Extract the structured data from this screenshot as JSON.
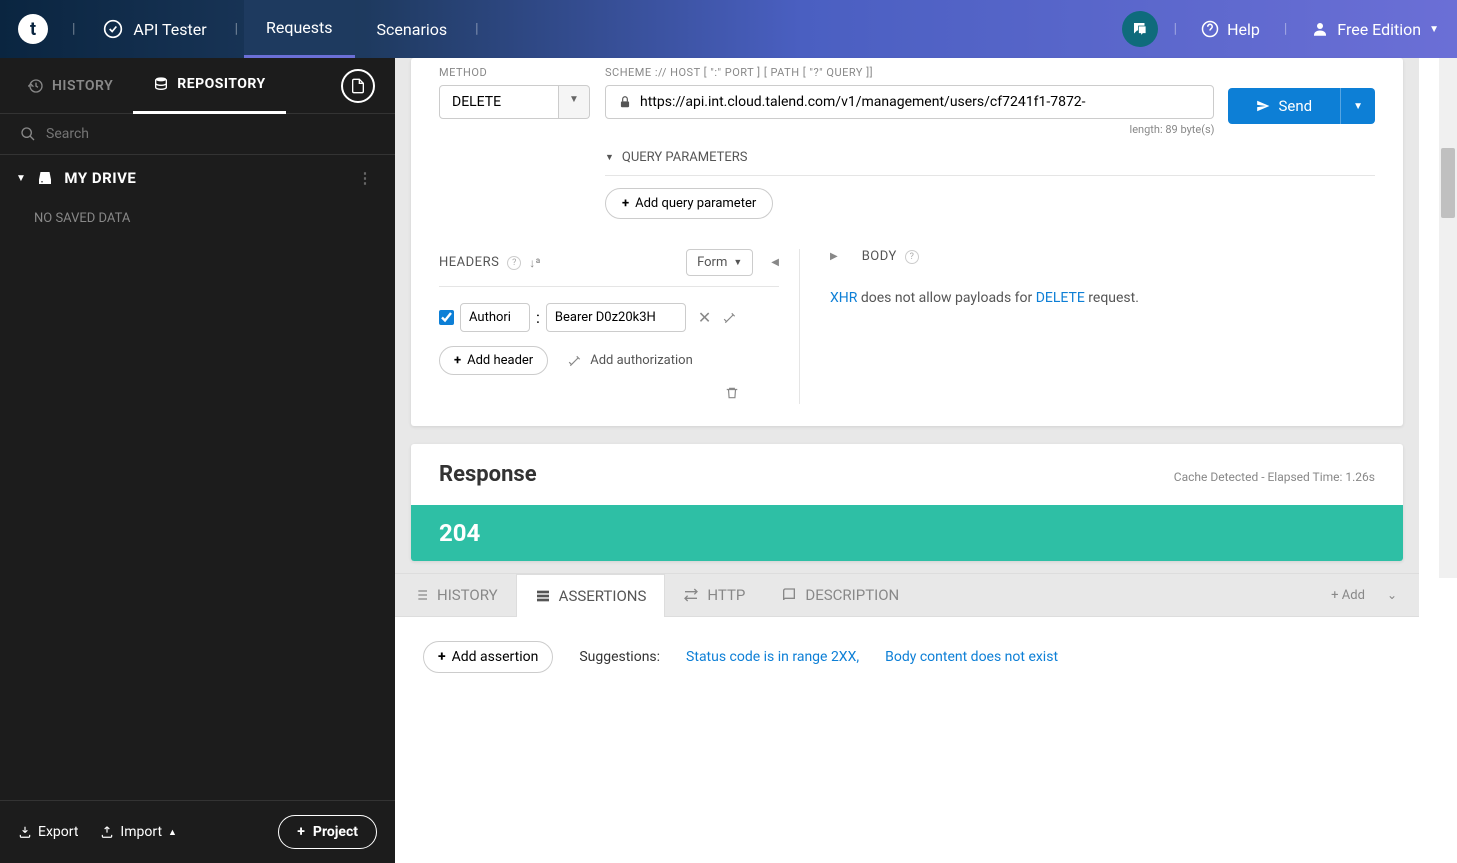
{
  "header": {
    "logo": "t",
    "apiTester": "API Tester",
    "requests": "Requests",
    "scenarios": "Scenarios",
    "help": "Help",
    "edition": "Free Edition"
  },
  "sidebar": {
    "history": "HISTORY",
    "repository": "REPOSITORY",
    "searchPlaceholder": "Search",
    "myDrive": "MY DRIVE",
    "noData": "NO SAVED DATA",
    "export": "Export",
    "import": "Import",
    "project": "Project"
  },
  "request": {
    "methodLabel": "METHOD",
    "method": "DELETE",
    "urlLabel": "SCHEME :// HOST [ \":\" PORT ] [ PATH [ \"?\" QUERY ]]",
    "url": "https://api.int.cloud.talend.com/v1/management/users/cf7241f1-7872-",
    "lengthText": "length: 89 byte(s)",
    "send": "Send",
    "queryParams": "QUERY PARAMETERS",
    "addQuery": "Add query parameter",
    "headersTitle": "HEADERS",
    "formMode": "Form",
    "bodyTitle": "BODY",
    "hdrName": "Authori",
    "hdrVal": "Bearer D0z20k3H",
    "addHeader": "Add header",
    "addAuth": "Add authorization",
    "bodyXhr": "XHR",
    "bodyMid": " does not allow payloads for ",
    "bodyDel": "DELETE",
    "bodyEnd": " request."
  },
  "response": {
    "title": "Response",
    "meta": "Cache Detected - Elapsed Time: 1.26s",
    "status": "204"
  },
  "panel": {
    "history": "HISTORY",
    "assertions": "ASSERTIONS",
    "http": "HTTP",
    "description": "DESCRIPTION",
    "add": "Add",
    "addAssertion": "Add assertion",
    "suggestions": "Suggestions:",
    "sug1": "Status code is in range 2XX",
    "sug2": "Body content does not exist"
  }
}
